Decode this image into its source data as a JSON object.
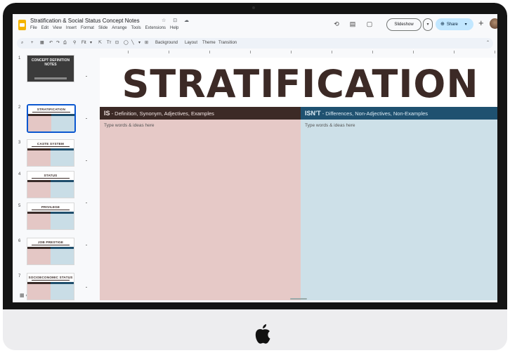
{
  "app": {
    "doc_title": "Stratification & Social Status Concept Notes",
    "title_icons": "☆ ⊡ ☁",
    "menu": [
      "File",
      "Edit",
      "View",
      "Insert",
      "Format",
      "Slide",
      "Arrange",
      "Tools",
      "Extensions",
      "Help"
    ]
  },
  "header_actions": {
    "history_icon": "⟲",
    "comments_icon": "▤",
    "meet_icon": "▢",
    "slideshow_label": "Slideshow",
    "slideshow_caret": "▾",
    "share_label": "Share",
    "share_caret": "▾",
    "add_icon": "+"
  },
  "toolbar": {
    "items": [
      "⌕",
      "+",
      "▦",
      "↶",
      "↷",
      "⎙",
      "⚲",
      "Fit",
      "▾",
      "⇱",
      "Tт",
      "⊡",
      "◯",
      "╲",
      "▾",
      "⊞",
      "Background",
      "Layout",
      "Theme",
      "Transition"
    ],
    "overflow": "⌃"
  },
  "filmstrip": {
    "slides": [
      {
        "num": "1",
        "label": "CONCEPT DEFINITION NOTES",
        "type": "cover"
      },
      {
        "num": "2",
        "label": "STRATIFICATION",
        "type": "table",
        "selected": true
      },
      {
        "num": "3",
        "label": "CASTE SYSTEM",
        "type": "table"
      },
      {
        "num": "4",
        "label": "STATUS",
        "type": "table"
      },
      {
        "num": "5",
        "label": "PRIVILEGE",
        "type": "table"
      },
      {
        "num": "6",
        "label": "JOB PRESTIGE",
        "type": "table"
      },
      {
        "num": "7",
        "label": "SOCIOECONOMIC STATUS",
        "type": "table"
      }
    ],
    "footer_icons": "▦  ‹"
  },
  "slide": {
    "title": "STRATIFICATION",
    "is_label": "IS",
    "is_desc": " - Definition, Synonym, Adjectives, Examples",
    "isnt_label": "ISN'T",
    "isnt_desc": " - Differences, Non-Adjectives, Non-Examples",
    "is_placeholder": "Type words & ideas here",
    "isnt_placeholder": "Type words & ideas here"
  },
  "colors": {
    "title_text": "#3c2a26",
    "is_header": "#3c2a26",
    "isnt_header": "#1f5170",
    "is_fill": "#e6c9c7",
    "isnt_fill": "#cde0e8",
    "share_button": "#c2e7ff"
  }
}
